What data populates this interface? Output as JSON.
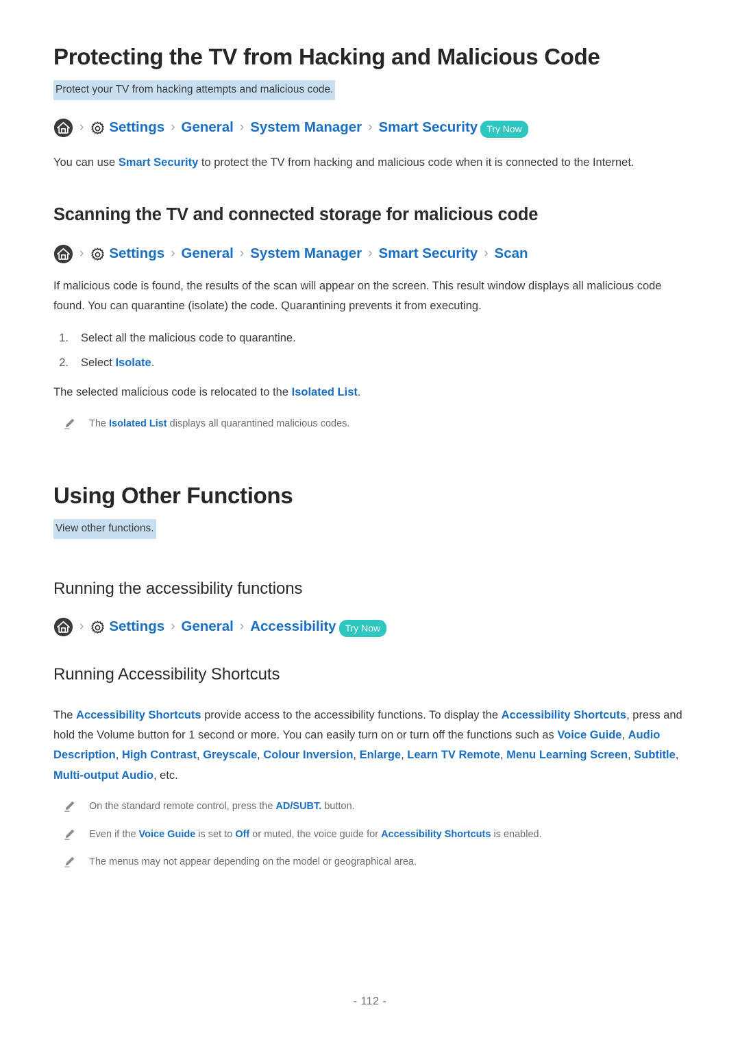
{
  "page": {
    "number_label": "- 112 -"
  },
  "icons": {
    "home": "home-icon",
    "gear": "gear-icon",
    "pencil": "pencil-note-icon",
    "separator": "›"
  },
  "colors": {
    "link": "#1a6fc4",
    "highlight_bg": "#c7dff0",
    "badge_bg": "#2dc6c0",
    "heading": "#262626",
    "body": "#3a3a3a",
    "note": "#6d6d6d"
  },
  "sections": [
    {
      "id": "protecting-tv",
      "title": "Protecting the TV from Hacking and Malicious Code",
      "summary": "Protect your TV from hacking attempts and malicious code.",
      "breadcrumb": {
        "items": [
          "Settings",
          "General",
          "System Manager",
          "Smart Security"
        ],
        "badge": "Try Now"
      },
      "paragraph": {
        "pre": "You can use ",
        "link": "Smart Security",
        "post": " to protect the TV from hacking and malicious code when it is connected to the Internet."
      }
    },
    {
      "id": "scanning",
      "title": "Scanning the TV and connected storage for malicious code",
      "breadcrumb": {
        "items": [
          "Settings",
          "General",
          "System Manager",
          "Smart Security",
          "Scan"
        ],
        "badge": ""
      },
      "paragraph": "If malicious code is found, the results of the scan will appear on the screen. This result window displays all malicious code found. You can quarantine (isolate) the code. Quarantining prevents it from executing.",
      "steps": [
        {
          "num": "1.",
          "pre": "Select all the malicious code to quarantine.",
          "link": "",
          "post": ""
        },
        {
          "num": "2.",
          "pre": "Select ",
          "link": "Isolate",
          "post": "."
        }
      ],
      "after_steps": {
        "pre": "The selected malicious code is relocated to the ",
        "link": "Isolated List",
        "post": "."
      },
      "notes": [
        {
          "pre": "The ",
          "link": "Isolated List",
          "post": " displays all quarantined malicious codes."
        }
      ]
    },
    {
      "id": "using-other-functions",
      "title": "Using Other Functions",
      "summary": "View other functions.",
      "subsection_title": "Running the accessibility functions",
      "breadcrumb": {
        "items": [
          "Settings",
          "General",
          "Accessibility"
        ],
        "badge": "Try Now"
      }
    },
    {
      "id": "accessibility-shortcuts",
      "title": "Running Accessibility Shortcuts",
      "paragraph_parts": [
        {
          "t": "The ",
          "k": "plain"
        },
        {
          "t": "Accessibility Shortcuts",
          "k": "link"
        },
        {
          "t": " provide access to the accessibility functions. To display the ",
          "k": "plain"
        },
        {
          "t": "Accessibility Shortcuts",
          "k": "link"
        },
        {
          "t": ", press and hold the Volume button for 1 second or more. You can easily turn on or turn off the functions such as ",
          "k": "plain"
        },
        {
          "t": "Voice Guide",
          "k": "link"
        },
        {
          "t": ", ",
          "k": "plain"
        },
        {
          "t": "Audio Description",
          "k": "link"
        },
        {
          "t": ", ",
          "k": "plain"
        },
        {
          "t": "High Contrast",
          "k": "link"
        },
        {
          "t": ", ",
          "k": "plain"
        },
        {
          "t": "Greyscale",
          "k": "link"
        },
        {
          "t": ", ",
          "k": "plain"
        },
        {
          "t": "Colour Inversion",
          "k": "link"
        },
        {
          "t": ", ",
          "k": "plain"
        },
        {
          "t": "Enlarge",
          "k": "link"
        },
        {
          "t": ", ",
          "k": "plain"
        },
        {
          "t": "Learn TV Remote",
          "k": "link"
        },
        {
          "t": ", ",
          "k": "plain"
        },
        {
          "t": "Menu Learning Screen",
          "k": "link"
        },
        {
          "t": ", ",
          "k": "plain"
        },
        {
          "t": "Subtitle",
          "k": "link"
        },
        {
          "t": ", ",
          "k": "plain"
        },
        {
          "t": "Multi-output Audio",
          "k": "link"
        },
        {
          "t": ", etc.",
          "k": "plain"
        }
      ],
      "notes": [
        {
          "pre": "On the standard remote control, press the ",
          "link": "AD/SUBT.",
          "post": " button."
        },
        {
          "pre": "Even if the ",
          "link": "Voice Guide",
          "mid": " is set to ",
          "link2": "Off",
          "post": " or muted, the voice guide for ",
          "link3": "Accessibility Shortcuts",
          "tail": " is enabled."
        },
        {
          "pre": "The menus may not appear depending on the model or geographical area.",
          "link": "",
          "post": ""
        }
      ]
    }
  ]
}
